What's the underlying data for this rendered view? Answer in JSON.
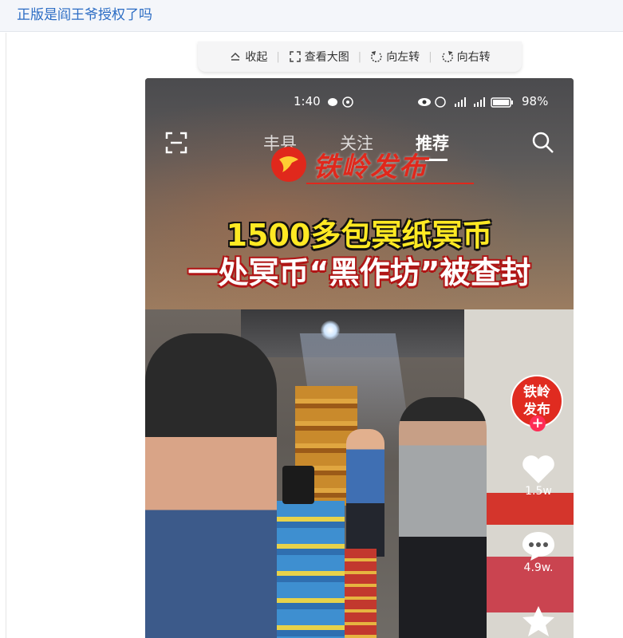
{
  "post": {
    "title": "正版是阎王爷授权了吗"
  },
  "toolbar": {
    "collapse": "收起",
    "view_large": "查看大图",
    "rotate_left": "向左转",
    "rotate_right": "向右转"
  },
  "phone": {
    "status": {
      "time": "1:40",
      "battery": "98%"
    },
    "nav": {
      "tabs": [
        "丰县",
        "关注",
        "推荐"
      ],
      "active_tab": "推荐"
    },
    "logo": "铁岭发布",
    "headline": {
      "line1": "1500多包冥纸冥币",
      "line2": "一处冥币“黑作坊”被查封"
    },
    "author_badge": {
      "line1": "铁岭",
      "line2": "发布",
      "follow": "+"
    },
    "likes": "1.5w",
    "comments": "4.9w."
  },
  "colors": {
    "title_link": "#2b6cc4",
    "headline_yellow": "#ffe923",
    "badge_red": "#e02b20"
  },
  "icons": [
    "collapse-icon",
    "fullscreen-icon",
    "rotate-left-icon",
    "rotate-right-icon",
    "scan-icon",
    "search-icon",
    "heart-icon",
    "comment-icon",
    "star-icon"
  ]
}
